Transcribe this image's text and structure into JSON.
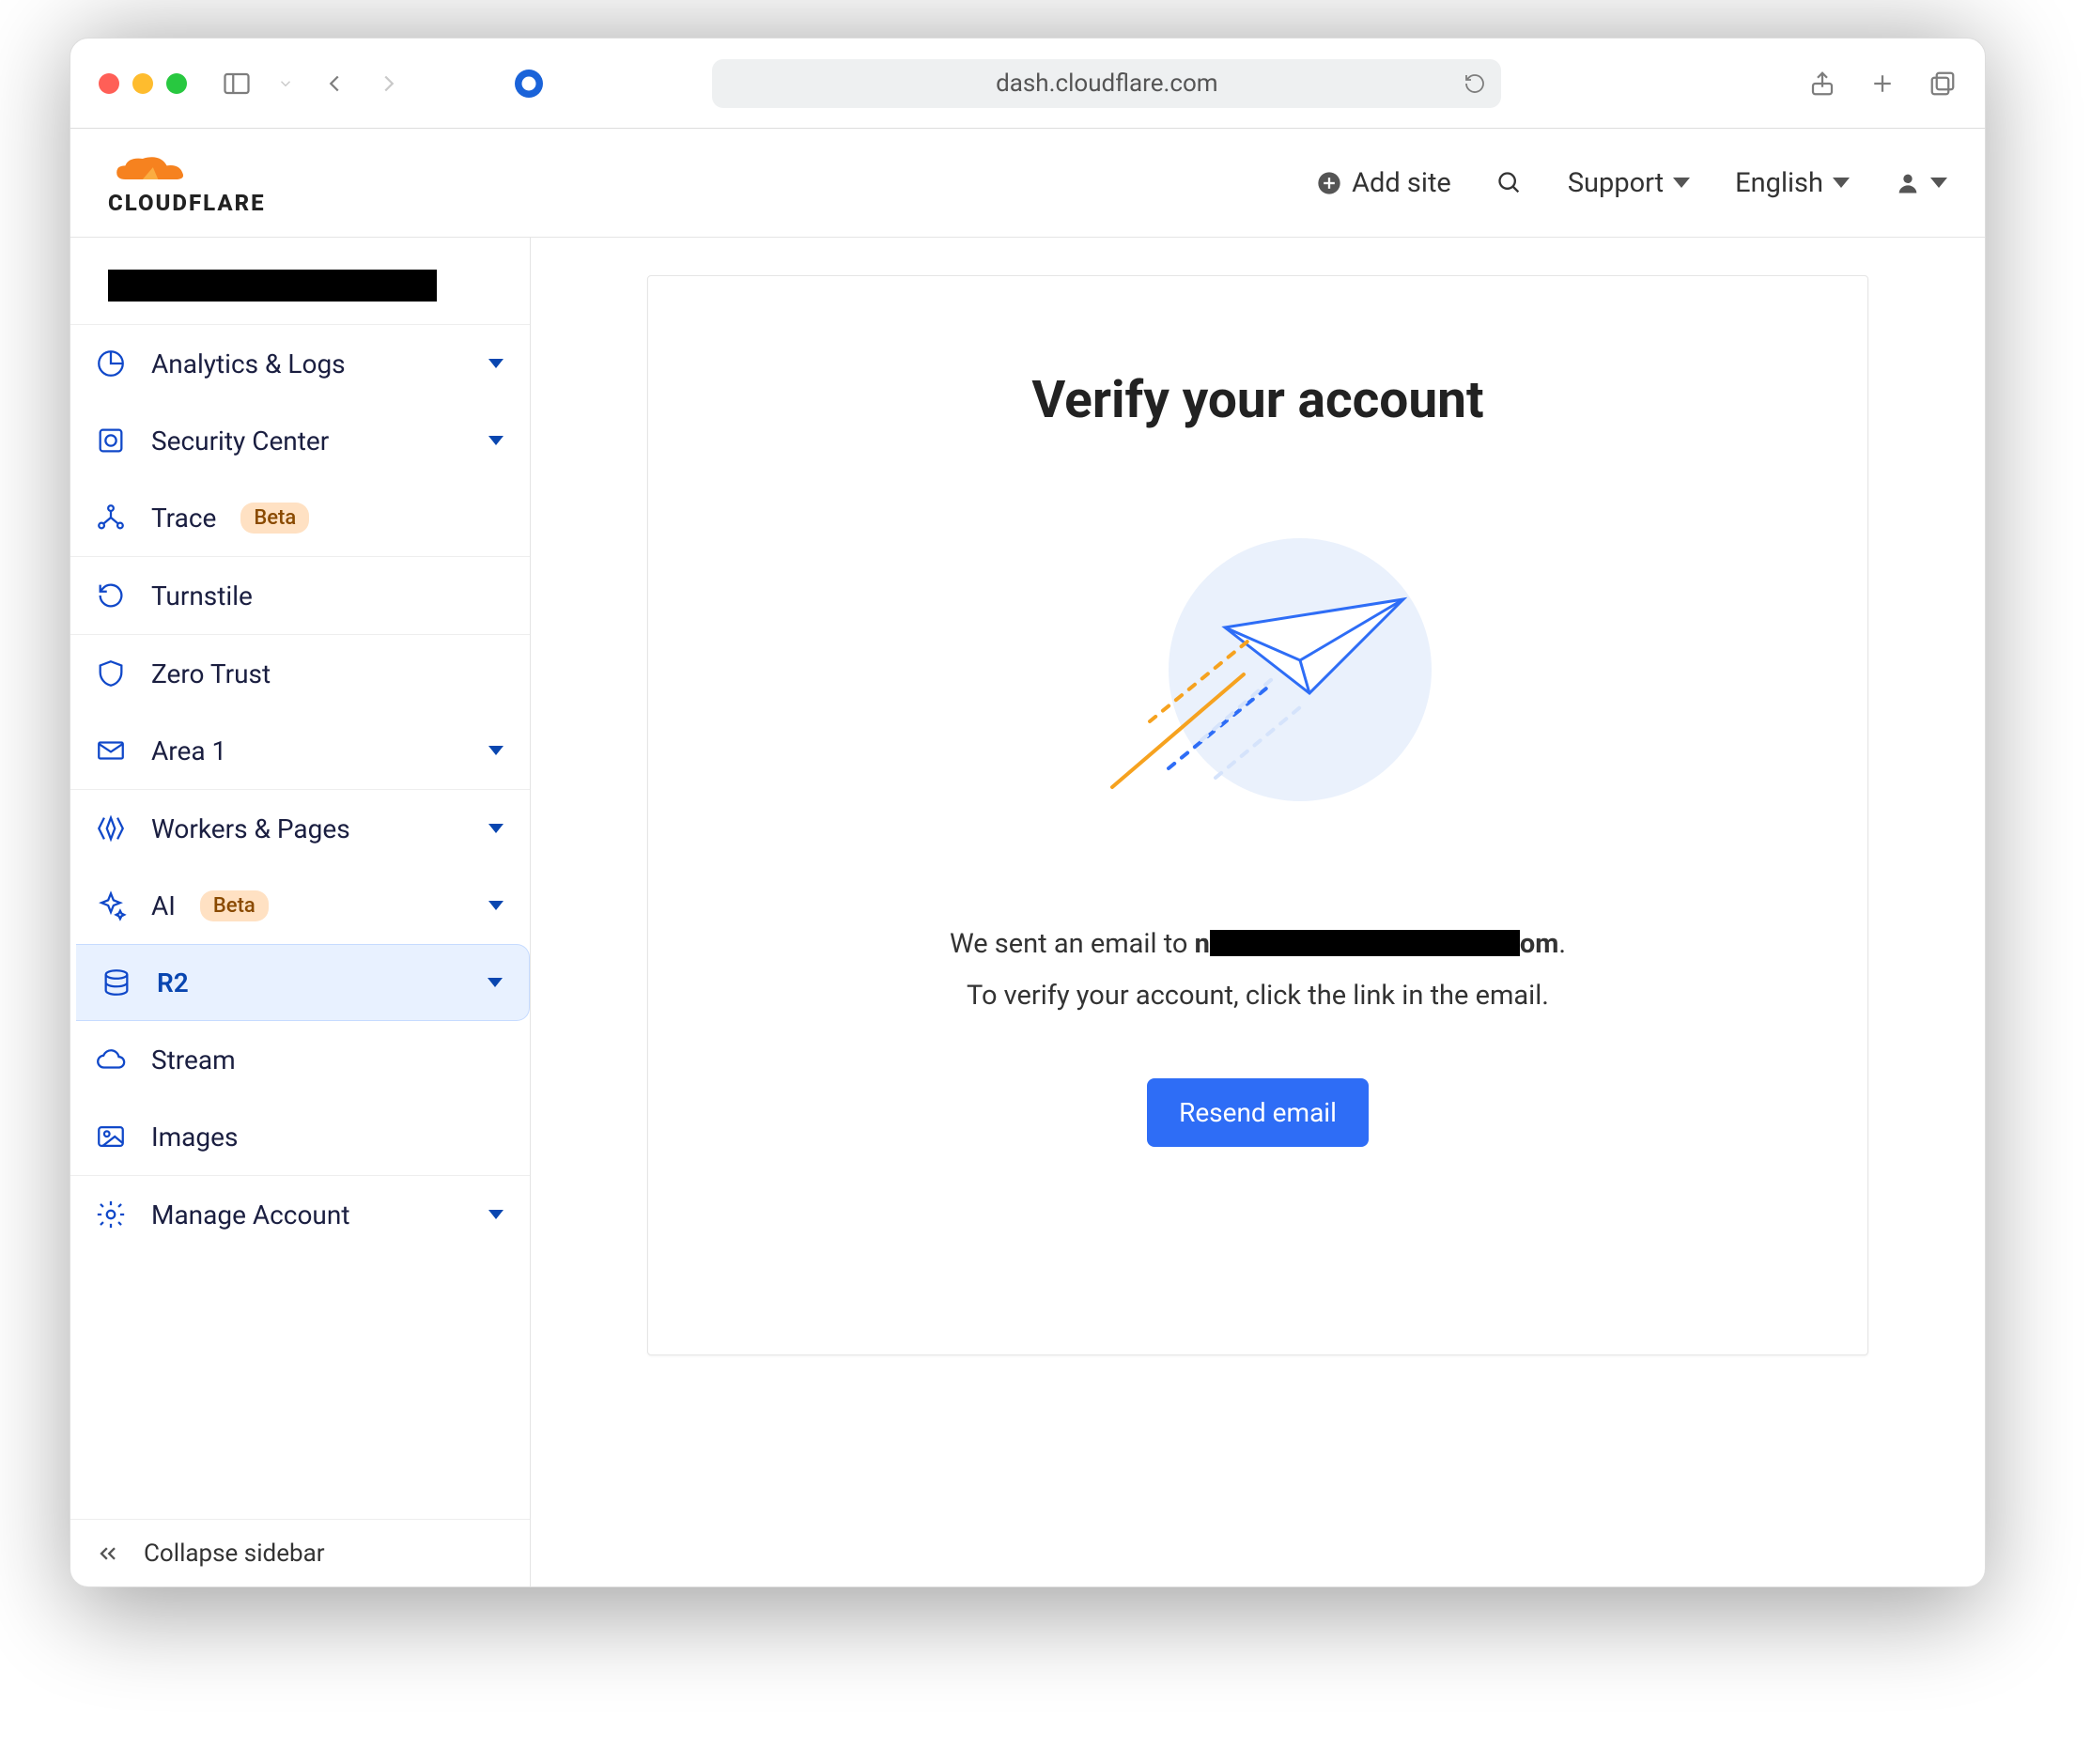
{
  "browser": {
    "address": "dash.cloudflare.com"
  },
  "header": {
    "logo_text": "CLOUDFLARE",
    "add_site": "Add site",
    "support": "Support",
    "language": "English"
  },
  "sidebar": {
    "items": [
      {
        "label": "Analytics & Logs",
        "icon": "pie",
        "expandable": true
      },
      {
        "label": "Security Center",
        "icon": "target",
        "expandable": true
      },
      {
        "label": "Trace",
        "icon": "network",
        "badge": "Beta"
      },
      {
        "label": "Turnstile",
        "icon": "refresh"
      },
      {
        "label": "Zero Trust",
        "icon": "shield"
      },
      {
        "label": "Area 1",
        "icon": "mail",
        "expandable": true
      },
      {
        "label": "Workers & Pages",
        "icon": "workers",
        "expandable": true
      },
      {
        "label": "AI",
        "icon": "sparkle",
        "badge": "Beta",
        "expandable": true
      },
      {
        "label": "R2",
        "icon": "db",
        "expandable": true,
        "active": true
      },
      {
        "label": "Stream",
        "icon": "cloud"
      },
      {
        "label": "Images",
        "icon": "image"
      },
      {
        "label": "Manage Account",
        "icon": "gear",
        "expandable": true
      }
    ],
    "collapse": "Collapse sidebar"
  },
  "card": {
    "title": "Verify your account",
    "line1_prefix": "We sent an email to ",
    "line1_bold_start": "n",
    "line1_bold_end": "om",
    "line1_period": ".",
    "line2": "To verify your account, click the link in the email.",
    "button": "Resend email"
  }
}
